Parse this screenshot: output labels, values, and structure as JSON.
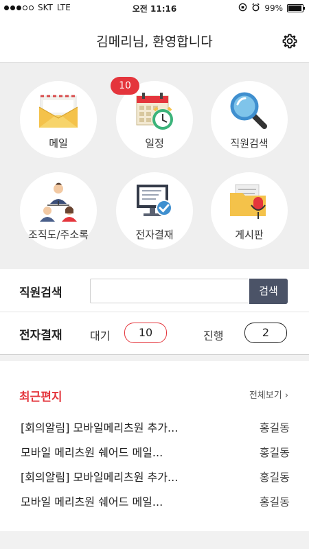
{
  "status_bar": {
    "carrier": "SKT",
    "network": "LTE",
    "time": "오전 11:16",
    "battery": "99%",
    "signal_bars": 3
  },
  "header": {
    "title": "김메리님, 환영합니다",
    "settings_icon": "gear-icon"
  },
  "menu": [
    {
      "label": "메일",
      "icon": "mail-icon"
    },
    {
      "label": "일정",
      "icon": "calendar-icon",
      "badge": "10"
    },
    {
      "label": "직원검색",
      "icon": "magnifier-icon"
    },
    {
      "label": "조직도/주소록",
      "icon": "people-icon"
    },
    {
      "label": "전자결재",
      "icon": "monitor-check-icon"
    },
    {
      "label": "게시판",
      "icon": "folder-mic-icon"
    }
  ],
  "search": {
    "label": "직원검색",
    "placeholder": "",
    "value": "",
    "button_label": "검색"
  },
  "approval": {
    "label": "전자결재",
    "waiting_label": "대기",
    "waiting_count": "10",
    "progress_label": "진행",
    "progress_count": "2"
  },
  "recent_mail": {
    "title": "최근편지",
    "view_all": "전체보기 ›",
    "items": [
      {
        "subject": "[회의알림] 모바일메리츠원 추가...",
        "sender": "홍길동"
      },
      {
        "subject": "모바일 메리츠원 쉐어드 메일...",
        "sender": "홍길동"
      },
      {
        "subject": "[회의알림] 모바일메리츠원 추가...",
        "sender": "홍길동"
      },
      {
        "subject": "모바일 메리츠원 쉐어드 메일...",
        "sender": "홍길동"
      }
    ]
  },
  "colors": {
    "accent_red": "#e4353c",
    "search_button": "#4b5367",
    "grid_background": "#efefef"
  }
}
